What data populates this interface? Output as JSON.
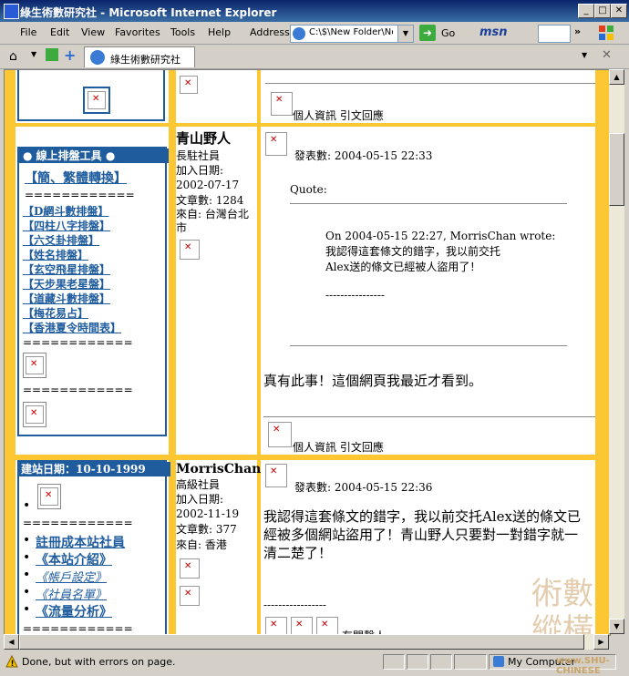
{
  "window": {
    "title": "綠生術數研究社 - Microsoft Internet Explorer",
    "buttons": {
      "minimize": "_",
      "maximize": "□",
      "close": "✕"
    }
  },
  "menu": {
    "items": [
      "File",
      "Edit",
      "View",
      "Favorites",
      "Tools",
      "Help"
    ]
  },
  "address": {
    "label": "Address",
    "value": "C:\\$\\New Folder\\Ne",
    "go_label": "Go"
  },
  "msn": {
    "label": "msn"
  },
  "tab": {
    "title": "綠生術數研究社"
  },
  "sidebar": {
    "tools_title": "● 線上排盤工具 ●",
    "convert_link": "【簡、繁體轉換】",
    "divider": "============",
    "tools": [
      "【D網斗數排盤】",
      "【四柱八字排盤】",
      "【六爻卦排盤】",
      "【姓名排盤】",
      "【玄空飛星排盤】",
      "【天步果老星盤】",
      "【道藏斗數排盤】",
      "【梅花易占】",
      "【香港夏令時間表】"
    ],
    "founded": "建站日期：10-10-1999",
    "bullet": "•",
    "site_links": [
      "註冊成本站社員",
      "《本站介紹》",
      "《帳戶設定》",
      "《社員名單》",
      "《流量分析》"
    ]
  },
  "posts": [
    {
      "author": "青山野人",
      "rank": "長駐社員",
      "joined": "加入日期: 2002-07-17",
      "count": "文章數: 1284",
      "from": "來自: 台灣台北市",
      "posted": "發表數: 2004-05-15 22:33",
      "quote_label": "Quote:",
      "quote_header": "On 2004-05-15 22:27, MorrisChan wrote:",
      "quote_lines": [
        "我認得這套條文的錯字，我以前交托",
        "Alex送的條文已經被人盜用了！"
      ],
      "quote_sig": "----------------",
      "body": "真有此事！這個網頁我最近才看到。",
      "actions": "個人資訊  引文回應"
    },
    {
      "author": "MorrisChan",
      "rank": "高級社員",
      "joined": "加入日期: 2002-11-19",
      "count": "文章數: 377",
      "from": "來自: 香港",
      "posted": "發表數: 2004-05-15 22:36",
      "body": "我認得這套條文的錯字，我以前交托Alex送的條文已經被多個網站盜用了！青山野人只要對一對錯字就一清二楚了！",
      "sig": "-----------------",
      "partial": "有關擊人"
    }
  ],
  "prev_actions": "個人資訊  引文回應",
  "watermark": [
    "術數",
    "縱橫"
  ],
  "watermark_url": "www.SHU-CHINESE",
  "status": {
    "text": "Done, but with errors on page.",
    "zone": "My Computer"
  },
  "colors": {
    "accent_yellow": "#fcc733",
    "nav_blue": "#1f5c9e"
  }
}
